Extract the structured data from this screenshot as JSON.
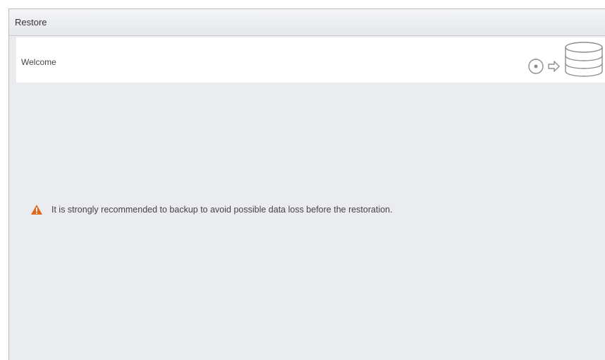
{
  "window": {
    "title": "Restore"
  },
  "welcome": {
    "title": "Welcome",
    "icons": [
      "restore-circle-icon",
      "arrow-right-icon",
      "database-icon"
    ]
  },
  "content": {
    "warning_icon": "warning-triangle-icon",
    "warning_text": "It is strongly recommended to backup to avoid possible data loss before the restoration."
  },
  "colors": {
    "warning": "#e06a1b",
    "panel_bg": "#eaecef",
    "icon_gray": "#8a8d91"
  }
}
